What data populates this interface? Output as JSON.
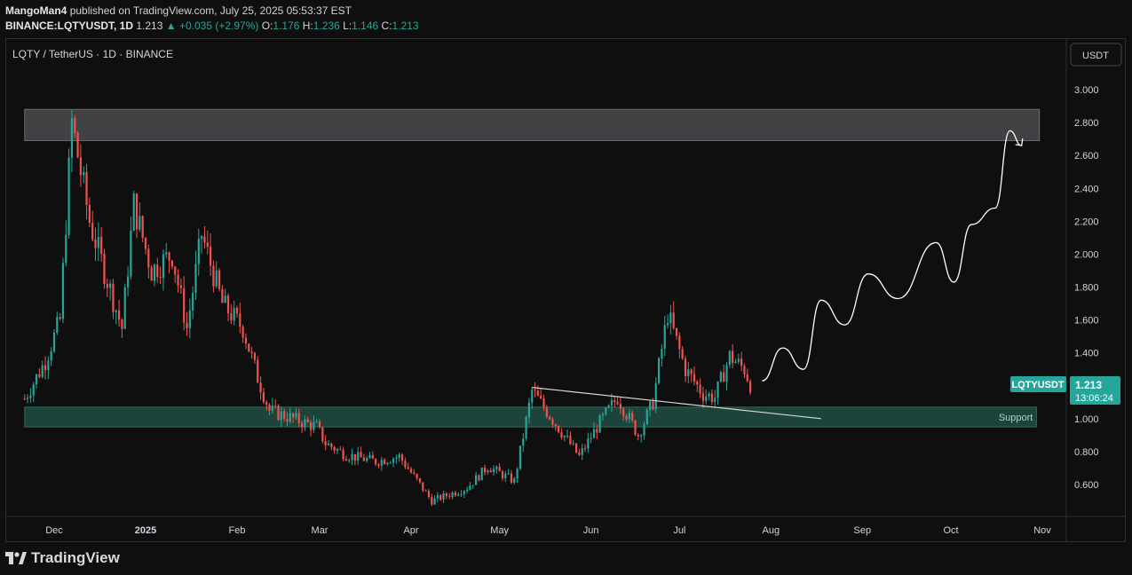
{
  "header": {
    "author": "MangoMan4",
    "published_text": "published on TradingView.com, July 25, 2025 05:53:37 EST",
    "symbol": "BINANCE:LQTYUSDT, 1D",
    "last": "1.213",
    "change": "+0.035 (+2.97%)",
    "o_label": "O:",
    "o_val": "1.176",
    "h_label": "H:",
    "h_val": "1.236",
    "l_label": "L:",
    "l_val": "1.146",
    "c_label": "C:",
    "c_val": "1.213"
  },
  "chart_title": "LQTY / TetherUS · 1D · BINANCE",
  "currency_button": "USDT",
  "price_tag": {
    "symbol": "LQTYUSDT",
    "price": "1.213",
    "countdown": "13:06:24"
  },
  "footer": {
    "brand": "TradingView"
  },
  "colors": {
    "up": "#26a69a",
    "down": "#ef5350",
    "zone": "#4a4a4e",
    "support": "#1f4a40",
    "background": "#0f0f0f"
  },
  "chart_data": {
    "type": "candlestick",
    "y_ticks": [
      "3.000",
      "2.800",
      "2.600",
      "2.400",
      "2.200",
      "2.000",
      "1.800",
      "1.600",
      "1.400",
      "1.200",
      "1.000",
      "0.800",
      "0.600"
    ],
    "x_ticks": [
      "Dec",
      "2025",
      "Feb",
      "Mar",
      "Apr",
      "May",
      "Jun",
      "Jul",
      "Aug",
      "Sep",
      "Oct",
      "Nov"
    ],
    "ylim": [
      0.45,
      3.1
    ],
    "grid": false,
    "zones": [
      {
        "label": "",
        "from": 2.69,
        "to": 2.88,
        "start": "2024-11-21",
        "end": "2025-10-31"
      },
      {
        "label": "Support",
        "from": 0.95,
        "to": 1.07,
        "start": "2024-11-21",
        "end": "2025-10-30"
      }
    ],
    "trendline": {
      "start_date": "2025-05-12",
      "start_price": 1.19,
      "end_date": "2025-08-18",
      "end_price": 1.0
    },
    "projection": [
      {
        "date": "2025-07-29",
        "price": 1.23
      },
      {
        "date": "2025-08-05",
        "price": 1.43
      },
      {
        "date": "2025-08-12",
        "price": 1.3
      },
      {
        "date": "2025-08-18",
        "price": 1.72
      },
      {
        "date": "2025-08-26",
        "price": 1.57
      },
      {
        "date": "2025-09-03",
        "price": 1.88
      },
      {
        "date": "2025-09-13",
        "price": 1.73
      },
      {
        "date": "2025-09-26",
        "price": 2.07
      },
      {
        "date": "2025-10-02",
        "price": 1.83
      },
      {
        "date": "2025-10-08",
        "price": 2.18
      },
      {
        "date": "2025-10-16",
        "price": 2.28
      },
      {
        "date": "2025-10-21",
        "price": 2.75
      },
      {
        "date": "2025-10-25",
        "price": 2.66
      }
    ],
    "price_path": [
      {
        "date": "2024-11-21",
        "price": 1.12
      },
      {
        "date": "2024-11-28",
        "price": 1.35
      },
      {
        "date": "2024-12-03",
        "price": 1.6
      },
      {
        "date": "2024-12-07",
        "price": 2.8
      },
      {
        "date": "2024-12-13",
        "price": 2.2
      },
      {
        "date": "2024-12-18",
        "price": 1.9
      },
      {
        "date": "2024-12-24",
        "price": 1.55
      },
      {
        "date": "2024-12-28",
        "price": 2.3
      },
      {
        "date": "2025-01-03",
        "price": 1.9
      },
      {
        "date": "2025-01-10",
        "price": 2.0
      },
      {
        "date": "2025-01-15",
        "price": 1.55
      },
      {
        "date": "2025-01-20",
        "price": 2.12
      },
      {
        "date": "2025-01-27",
        "price": 1.7
      },
      {
        "date": "2025-02-03",
        "price": 1.55
      },
      {
        "date": "2025-02-08",
        "price": 1.25
      },
      {
        "date": "2025-02-12",
        "price": 1.05
      },
      {
        "date": "2025-02-20",
        "price": 1.0
      },
      {
        "date": "2025-02-28",
        "price": 0.95
      },
      {
        "date": "2025-03-03",
        "price": 0.85
      },
      {
        "date": "2025-03-10",
        "price": 0.78
      },
      {
        "date": "2025-03-20",
        "price": 0.74
      },
      {
        "date": "2025-03-28",
        "price": 0.77
      },
      {
        "date": "2025-04-04",
        "price": 0.6
      },
      {
        "date": "2025-04-08",
        "price": 0.5
      },
      {
        "date": "2025-04-20",
        "price": 0.58
      },
      {
        "date": "2025-04-27",
        "price": 0.71
      },
      {
        "date": "2025-05-06",
        "price": 0.62
      },
      {
        "date": "2025-05-12",
        "price": 1.17
      },
      {
        "date": "2025-05-20",
        "price": 0.97
      },
      {
        "date": "2025-05-28",
        "price": 0.77
      },
      {
        "date": "2025-06-03",
        "price": 0.95
      },
      {
        "date": "2025-06-10",
        "price": 1.13
      },
      {
        "date": "2025-06-17",
        "price": 0.9
      },
      {
        "date": "2025-06-22",
        "price": 1.1
      },
      {
        "date": "2025-06-27",
        "price": 1.64
      },
      {
        "date": "2025-07-03",
        "price": 1.3
      },
      {
        "date": "2025-07-09",
        "price": 1.15
      },
      {
        "date": "2025-07-13",
        "price": 1.13
      },
      {
        "date": "2025-07-18",
        "price": 1.38
      },
      {
        "date": "2025-07-23",
        "price": 1.3
      },
      {
        "date": "2025-07-25",
        "price": 1.21
      }
    ]
  }
}
